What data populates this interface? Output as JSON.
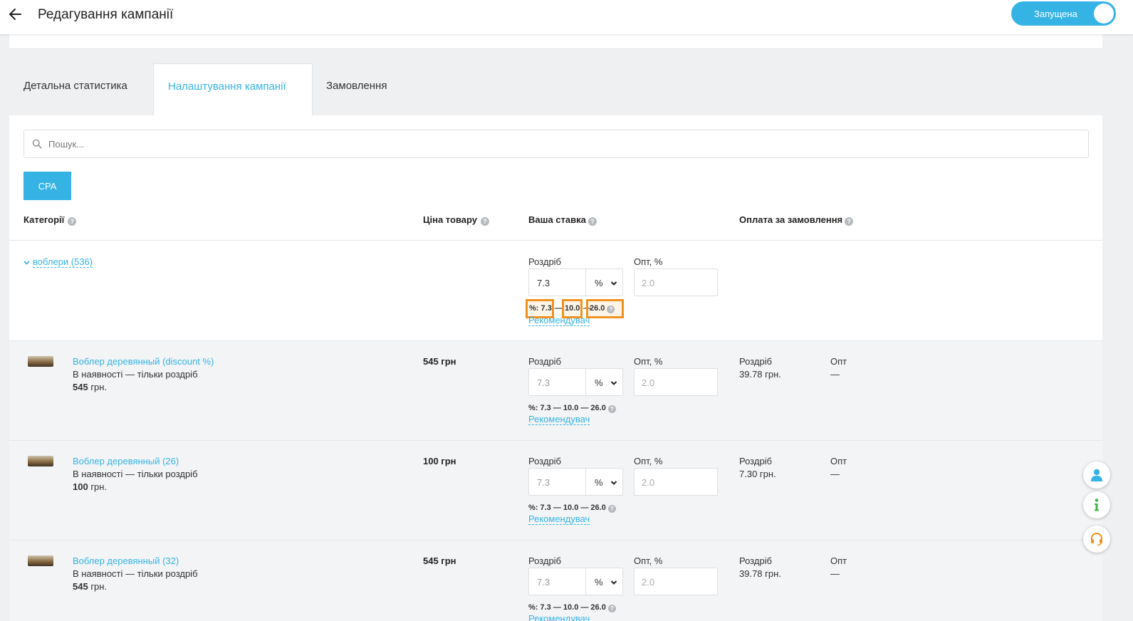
{
  "header": {
    "title": "Редагування кампанії",
    "status_label": "Запущена"
  },
  "tabs": [
    {
      "label": "Детальна статистика"
    },
    {
      "label": "Налаштування кампанії"
    },
    {
      "label": "Замовлення"
    }
  ],
  "search": {
    "placeholder": "Пошук..."
  },
  "cpa_label": "CPA",
  "columns": {
    "categories": "Категорії",
    "price": "Ціна товару",
    "bid": "Ваша ставка",
    "payment": "Оплата за замовлення"
  },
  "labels": {
    "retail": "Роздріб",
    "wholesale_pct": "Опт, %",
    "unit": "%",
    "recommender": "Рекомендувач",
    "range_prefix": "%:",
    "wholesale": "Опт",
    "none": "—",
    "currency": "грн."
  },
  "group": {
    "name": "воблери (536)",
    "bid_value": "7.3",
    "opt_placeholder": "2.0",
    "range_min": "7.3",
    "range_mid": "10.0",
    "range_max": "26.0"
  },
  "products": [
    {
      "name": "Воблер деревянный (discount %)",
      "availability": "В наявності — тільки роздріб",
      "price_bold": "545",
      "price_col": "545 грн",
      "bid_placeholder": "7.3",
      "opt_placeholder": "2.0",
      "range": "%: 7.3 — 10.0 — 26.0",
      "pay_retail": "39.78 грн.",
      "pay_wholesale": "—"
    },
    {
      "name": "Воблер деревянный (26)",
      "availability": "В наявності — тільки роздріб",
      "price_bold": "100",
      "price_col": "100 грн",
      "bid_placeholder": "7.3",
      "opt_placeholder": "2.0",
      "range": "%: 7.3 — 10.0 — 26.0",
      "pay_retail": "7.30 грн.",
      "pay_wholesale": "—"
    },
    {
      "name": "Воблер деревянный (32)",
      "availability": "В наявності — тільки роздріб",
      "price_bold": "545",
      "price_col": "545 грн",
      "bid_placeholder": "7.3",
      "opt_placeholder": "2.0",
      "range": "%: 7.3 — 10.0 — 26.0",
      "pay_retail": "39.78 грн.",
      "pay_wholesale": "—"
    }
  ],
  "help_glyph": "?",
  "colors": {
    "accent": "#35b3e5",
    "highlight": "#f0921f",
    "profile_icon": "#35b3e5",
    "info_icon": "#3cb54a",
    "support_icon": "#f0921f"
  },
  "icons": [
    "back-arrow-icon",
    "search-icon",
    "chevron-down-icon",
    "help-icon",
    "select-arrow-icon",
    "profile-icon",
    "info-icon",
    "support-headset-icon"
  ]
}
